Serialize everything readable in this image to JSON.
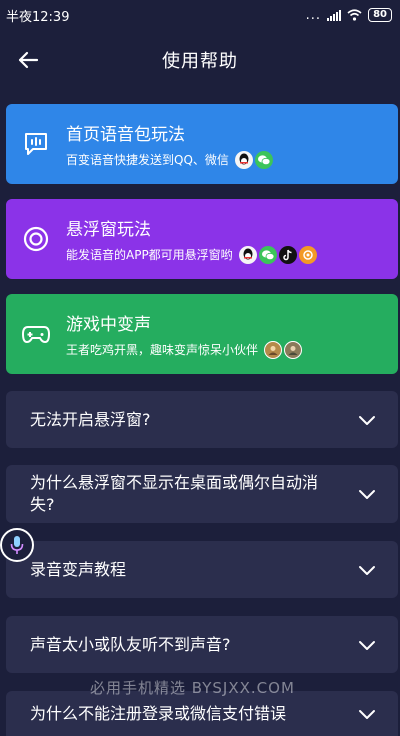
{
  "status": {
    "time": "半夜12:39",
    "dots": "...",
    "battery": "80"
  },
  "header": {
    "title": "使用帮助"
  },
  "cards": [
    {
      "title": "首页语音包玩法",
      "subtitle": "百变语音快捷发送到QQ、微信",
      "color": "#2f86e8",
      "icon": "chat-bubble-icon",
      "apps": [
        "qq-icon",
        "wechat-icon"
      ]
    },
    {
      "title": "悬浮窗玩法",
      "subtitle": "能发语音的APP都可用悬浮窗哟",
      "color": "#8b33e8",
      "icon": "float-ring-icon",
      "apps": [
        "qq-icon",
        "wechat-icon",
        "tiktok-icon",
        "app-icon"
      ]
    },
    {
      "title": "游戏中变声",
      "subtitle": "王者吃鸡开黑，趣味变声惊呆小伙伴",
      "color": "#25ad5f",
      "icon": "gamepad-icon",
      "apps": [
        "game-avatar-icon",
        "game-avatar-icon"
      ]
    }
  ],
  "faqs": [
    "无法开启悬浮窗?",
    "为什么悬浮窗不显示在桌面或偶尔自动消失?",
    "录音变声教程",
    "声音太小或队友听不到声音?",
    "为什么不能注册登录或微信支付错误"
  ],
  "watermark": "必用手机精选  BYSJXX.COM"
}
